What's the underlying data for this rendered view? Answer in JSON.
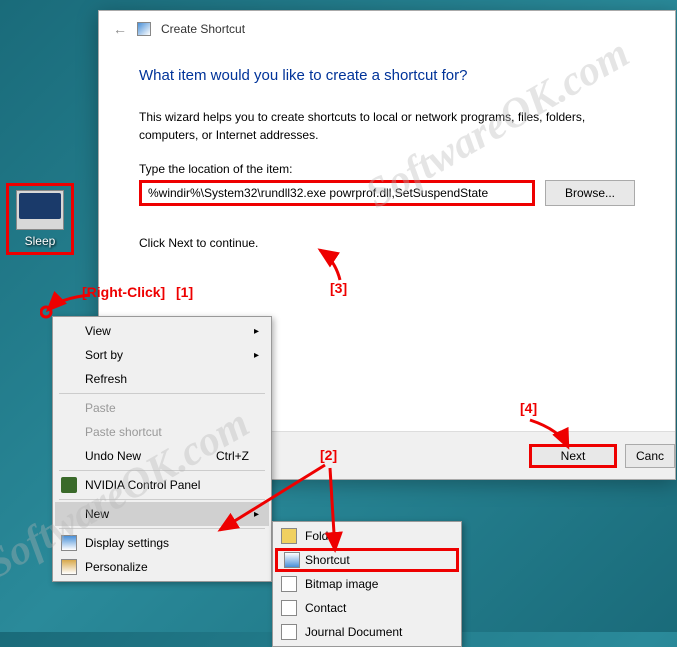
{
  "desktop": {
    "icon_label": "Sleep"
  },
  "dialog": {
    "title": "Create Shortcut",
    "heading": "What item would you like to create a shortcut for?",
    "description": "This wizard helps you to create shortcuts to local or network programs, files, folders, computers, or Internet addresses.",
    "input_label": "Type the location of the item:",
    "input_value": "%windir%\\System32\\rundll32.exe powrprof.dll,SetSuspendState",
    "browse_label": "Browse...",
    "continue_text": "Click Next to continue.",
    "next_label": "Next",
    "cancel_label": "Canc"
  },
  "context_menu": {
    "items": [
      {
        "label": "View",
        "has_arrow": true
      },
      {
        "label": "Sort by",
        "has_arrow": true
      },
      {
        "label": "Refresh"
      },
      {
        "label": "Paste",
        "disabled": true
      },
      {
        "label": "Paste shortcut",
        "disabled": true
      },
      {
        "label": "Undo New",
        "shortcut": "Ctrl+Z"
      },
      {
        "label": "NVIDIA Control Panel",
        "icon": "nvidia"
      },
      {
        "label": "New",
        "has_arrow": true,
        "highlighted": true
      },
      {
        "label": "Display settings",
        "icon": "display"
      },
      {
        "label": "Personalize",
        "icon": "personalize"
      }
    ]
  },
  "submenu": {
    "items": [
      {
        "label": "Folder",
        "icon": "folder"
      },
      {
        "label": "Shortcut",
        "icon": "shortcut",
        "highlighted": true
      },
      {
        "label": "Bitmap image",
        "icon": "bitmap"
      },
      {
        "label": "Contact",
        "icon": "contact"
      },
      {
        "label": "Journal Document",
        "icon": "journal"
      }
    ]
  },
  "annotations": {
    "a1": "[1]",
    "a2": "[2]",
    "a3": "[3]",
    "a4": "[4]",
    "rc": "[Right-Click]"
  },
  "watermark": "SoftwareOK.com"
}
